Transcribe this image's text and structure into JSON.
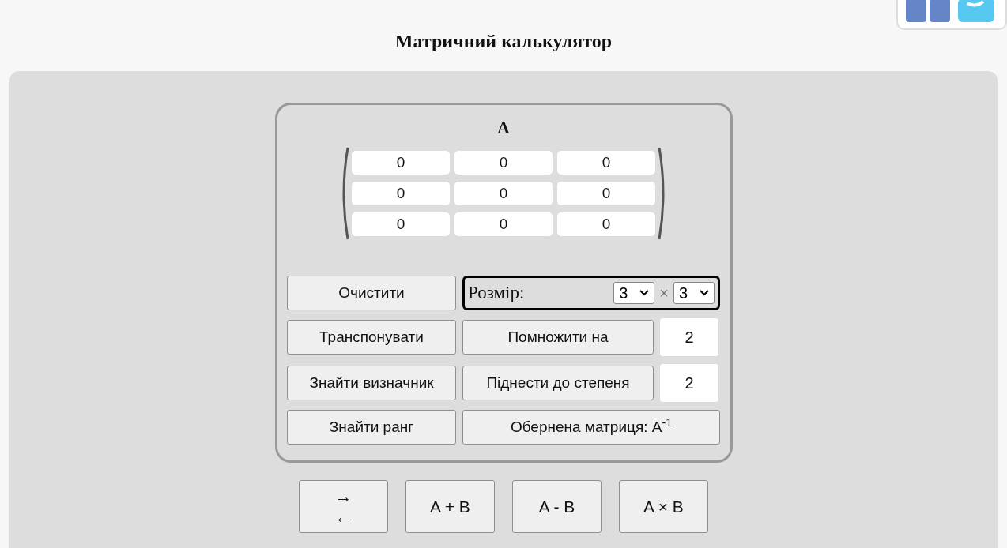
{
  "title": "Матричний калькулятор",
  "matrix": {
    "name": "A",
    "rows": [
      [
        "0",
        "0",
        "0"
      ],
      [
        "0",
        "0",
        "0"
      ],
      [
        "0",
        "0",
        "0"
      ]
    ]
  },
  "actions": [
    {
      "kind": "button",
      "label": "Очистити"
    },
    {
      "kind": "size",
      "label": "Розмір:",
      "rows": "3",
      "separator": "×",
      "cols": "3"
    },
    {
      "kind": "button",
      "label": "Транспонувати"
    },
    {
      "kind": "button_input",
      "label": "Помножити на",
      "value": "2"
    },
    {
      "kind": "button",
      "label": "Знайти визначник"
    },
    {
      "kind": "button_input",
      "label": "Піднести до степеня",
      "value": "2"
    },
    {
      "kind": "button",
      "label": "Знайти ранг"
    },
    {
      "kind": "button",
      "label": "Обернена матриця: A$^{-1}$"
    }
  ],
  "operations": [
    {
      "kind": "swap",
      "lines": [
        "→",
        "←"
      ]
    },
    {
      "kind": "op",
      "label": "A + B"
    },
    {
      "kind": "op",
      "label": "A - B"
    },
    {
      "kind": "op",
      "label": "A × B"
    }
  ]
}
